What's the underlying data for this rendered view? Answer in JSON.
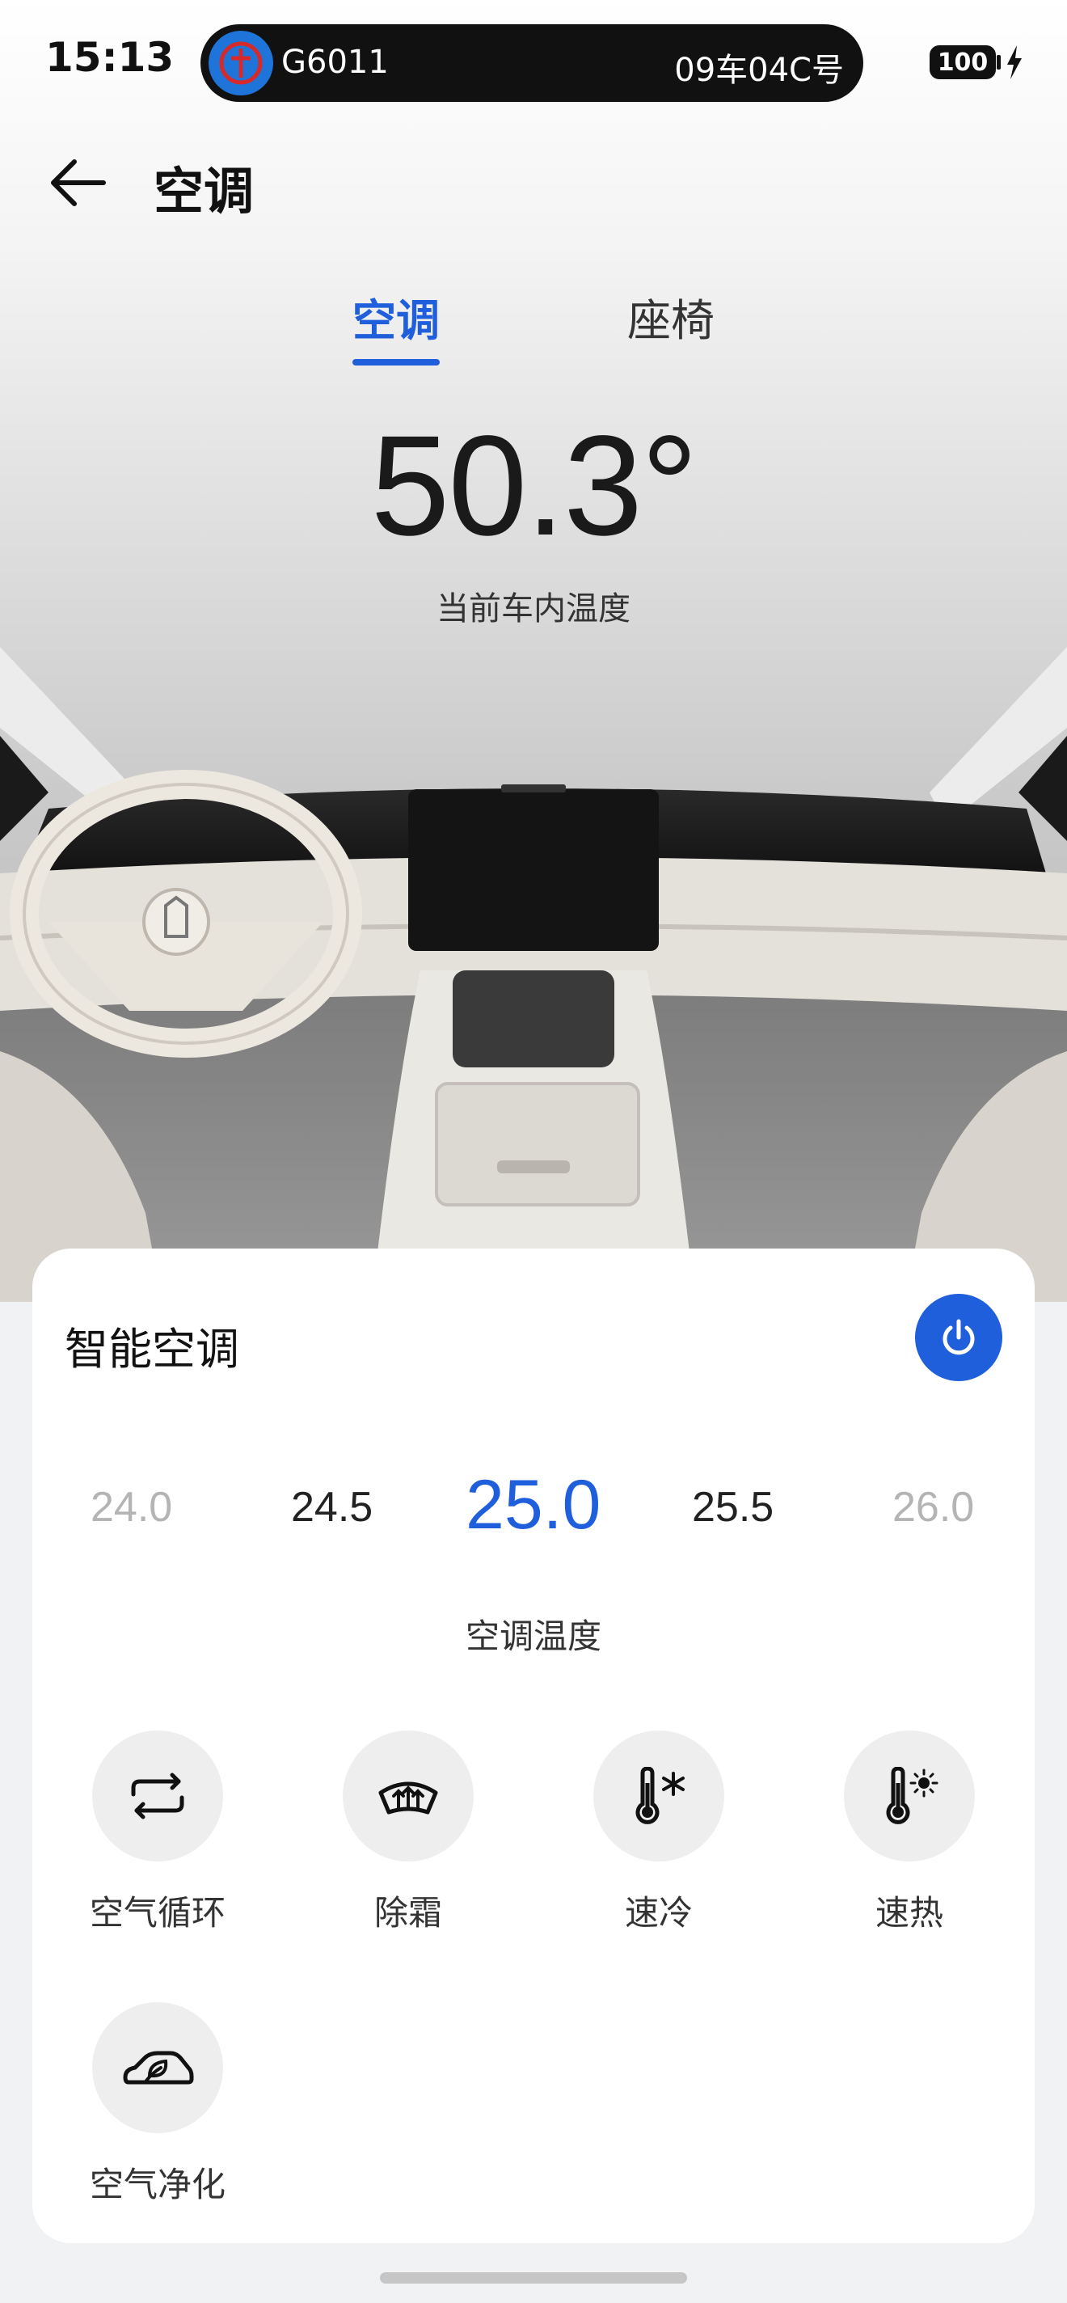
{
  "status_bar": {
    "time": "15:13",
    "train_number": "G6011",
    "seat": "09车04C号",
    "battery": "100",
    "logo_icon": "china-railway-logo-icon",
    "charge_icon": "charging-bolt-icon"
  },
  "header": {
    "title": "空调",
    "back_icon": "arrow-left-icon"
  },
  "tabs": [
    {
      "label": "空调",
      "active": true
    },
    {
      "label": "座椅",
      "active": false
    }
  ],
  "cabin": {
    "temperature": "50.3°",
    "label": "当前车内温度"
  },
  "card": {
    "title": "智能空调",
    "power_icon": "power-icon",
    "temperature_options": [
      "24.0",
      "24.5",
      "25.0",
      "25.5",
      "26.0"
    ],
    "selected_temperature": "25.0",
    "temperature_label": "空调温度",
    "functions": [
      {
        "label": "空气循环",
        "icon": "air-circulation-icon"
      },
      {
        "label": "除霜",
        "icon": "defrost-icon"
      },
      {
        "label": "速冷",
        "icon": "quick-cool-icon"
      },
      {
        "label": "速热",
        "icon": "quick-heat-icon"
      },
      {
        "label": "空气净化",
        "icon": "air-purify-icon"
      }
    ]
  },
  "colors": {
    "accent": "#1f5fdc",
    "muted_text": "#b4b4b4",
    "circle_bg": "#eeeeee"
  }
}
